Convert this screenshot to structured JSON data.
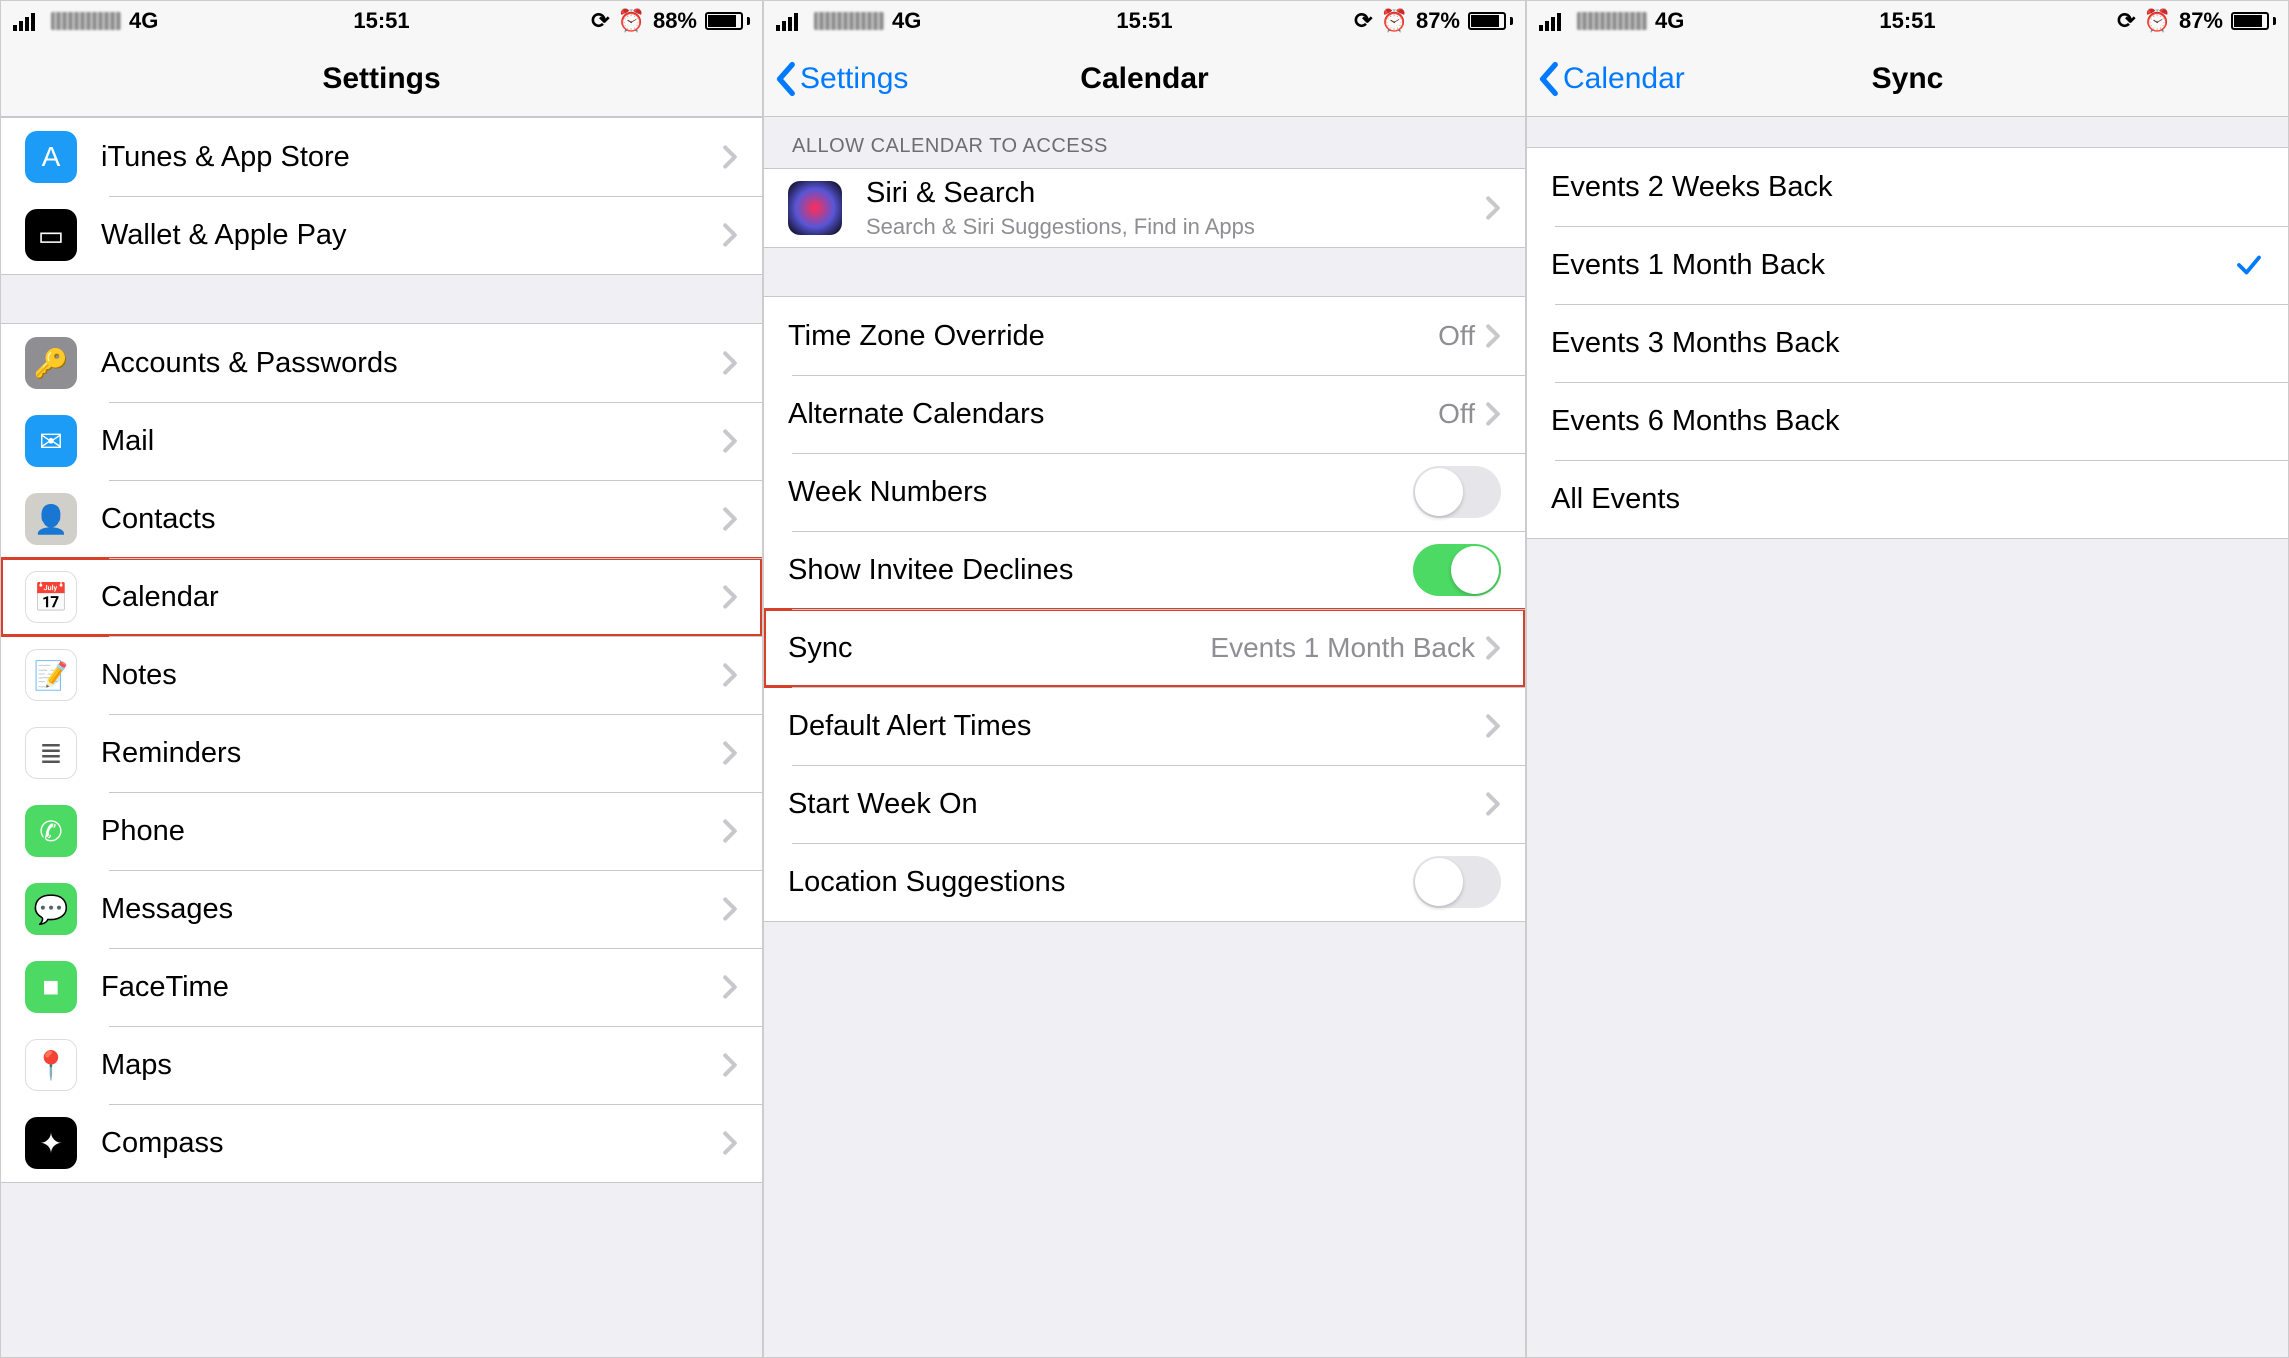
{
  "s1": {
    "status": {
      "net": "4G",
      "time": "15:51",
      "batt": "88%",
      "fill": "88%"
    },
    "title": "Settings",
    "g1": [
      {
        "label": "iTunes & App Store",
        "icon": "app-store",
        "bg": "#1c9cf6"
      },
      {
        "label": "Wallet & Apple Pay",
        "icon": "wallet",
        "bg": "#000"
      }
    ],
    "g2": [
      {
        "label": "Accounts & Passwords",
        "icon": "key",
        "bg": "#8e8e93"
      },
      {
        "label": "Mail",
        "icon": "mail",
        "bg": "#1c9cf6"
      },
      {
        "label": "Contacts",
        "icon": "contacts",
        "bg": "#d1cfc9"
      },
      {
        "label": "Calendar",
        "icon": "calendar",
        "bg": "#fff",
        "hl": true
      },
      {
        "label": "Notes",
        "icon": "notes",
        "bg": "#fff"
      },
      {
        "label": "Reminders",
        "icon": "reminders",
        "bg": "#fff"
      },
      {
        "label": "Phone",
        "icon": "phone",
        "bg": "#4cd964"
      },
      {
        "label": "Messages",
        "icon": "messages",
        "bg": "#4cd964"
      },
      {
        "label": "FaceTime",
        "icon": "facetime",
        "bg": "#4cd964"
      },
      {
        "label": "Maps",
        "icon": "maps",
        "bg": "#fff"
      },
      {
        "label": "Compass",
        "icon": "compass",
        "bg": "#000"
      }
    ]
  },
  "s2": {
    "status": {
      "net": "4G",
      "time": "15:51",
      "batt": "87%",
      "fill": "87%"
    },
    "back": "Settings",
    "title": "Calendar",
    "section": "ALLOW CALENDAR TO ACCESS",
    "siri": {
      "title": "Siri & Search",
      "sub": "Search & Siri Suggestions, Find in Apps"
    },
    "rows": [
      {
        "label": "Time Zone Override",
        "value": "Off",
        "type": "link"
      },
      {
        "label": "Alternate Calendars",
        "value": "Off",
        "type": "link"
      },
      {
        "label": "Week Numbers",
        "type": "toggle",
        "on": false
      },
      {
        "label": "Show Invitee Declines",
        "type": "toggle",
        "on": true
      },
      {
        "label": "Sync",
        "value": "Events 1 Month Back",
        "type": "link",
        "hl": true
      },
      {
        "label": "Default Alert Times",
        "type": "link"
      },
      {
        "label": "Start Week On",
        "type": "link"
      },
      {
        "label": "Location Suggestions",
        "type": "toggle",
        "on": false
      }
    ]
  },
  "s3": {
    "status": {
      "net": "4G",
      "time": "15:51",
      "batt": "87%",
      "fill": "87%"
    },
    "back": "Calendar",
    "title": "Sync",
    "rows": [
      {
        "label": "Events 2 Weeks Back"
      },
      {
        "label": "Events 1 Month Back",
        "checked": true
      },
      {
        "label": "Events 3 Months Back"
      },
      {
        "label": "Events 6 Months Back"
      },
      {
        "label": "All Events"
      }
    ]
  }
}
